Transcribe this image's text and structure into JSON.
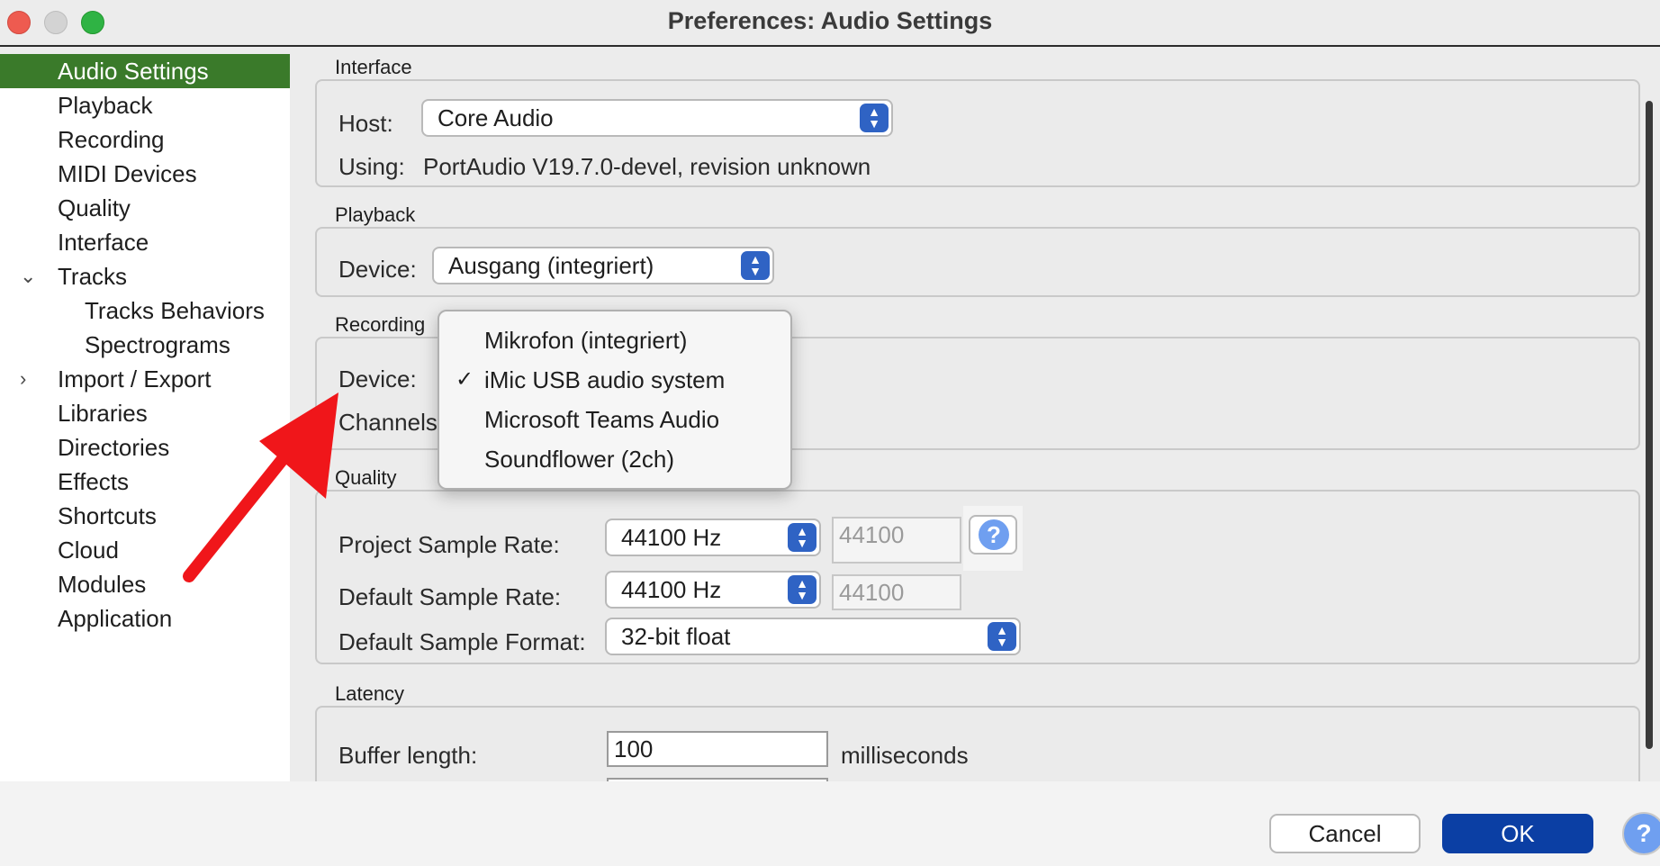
{
  "window": {
    "title": "Preferences: Audio Settings"
  },
  "sidebar": {
    "items": [
      {
        "label": "Audio Settings"
      },
      {
        "label": "Playback"
      },
      {
        "label": "Recording"
      },
      {
        "label": "MIDI Devices"
      },
      {
        "label": "Quality"
      },
      {
        "label": "Interface"
      },
      {
        "label": "Tracks"
      },
      {
        "label": "Tracks Behaviors"
      },
      {
        "label": "Spectrograms"
      },
      {
        "label": "Import / Export"
      },
      {
        "label": "Libraries"
      },
      {
        "label": "Directories"
      },
      {
        "label": "Effects"
      },
      {
        "label": "Shortcuts"
      },
      {
        "label": "Cloud"
      },
      {
        "label": "Modules"
      },
      {
        "label": "Application"
      }
    ],
    "selected": "Audio Settings",
    "expanded_glyph": "⌄",
    "collapsed_glyph": "›"
  },
  "interface": {
    "section_title": "Interface",
    "host_label": "Host:",
    "host_value": "Core Audio",
    "using_label": "Using:",
    "using_value": "PortAudio V19.7.0-devel, revision unknown"
  },
  "playback": {
    "section_title": "Playback",
    "device_label": "Device:",
    "device_value": "Ausgang (integriert)"
  },
  "recording": {
    "section_title": "Recording",
    "device_label": "Device:",
    "channels_label": "Channels",
    "menu_options": [
      {
        "label": "Mikrofon (integriert)",
        "checked": false
      },
      {
        "label": "iMic USB audio system",
        "checked": true
      },
      {
        "label": "Microsoft Teams Audio",
        "checked": false
      },
      {
        "label": "Soundflower (2ch)",
        "checked": false
      }
    ],
    "check_glyph": "✓"
  },
  "quality": {
    "section_title": "Quality",
    "project_rate_label": "Project Sample Rate:",
    "project_rate_value": "44100 Hz",
    "project_rate_text": "44100",
    "default_rate_label": "Default Sample Rate:",
    "default_rate_value": "44100 Hz",
    "default_rate_text": "44100",
    "format_label": "Default Sample Format:",
    "format_value": "32-bit float",
    "help_glyph": "?"
  },
  "latency": {
    "section_title": "Latency",
    "buffer_label": "Buffer length:",
    "buffer_value": "100",
    "buffer_unit": "milliseconds"
  },
  "footer": {
    "cancel_label": "Cancel",
    "ok_label": "OK",
    "help_glyph": "?"
  },
  "colors": {
    "selected_sidebar": "#3a7a2a",
    "ok_button": "#0b3fa4",
    "stepper": "#2f63c4",
    "annotation_arrow": "#f0161a"
  }
}
